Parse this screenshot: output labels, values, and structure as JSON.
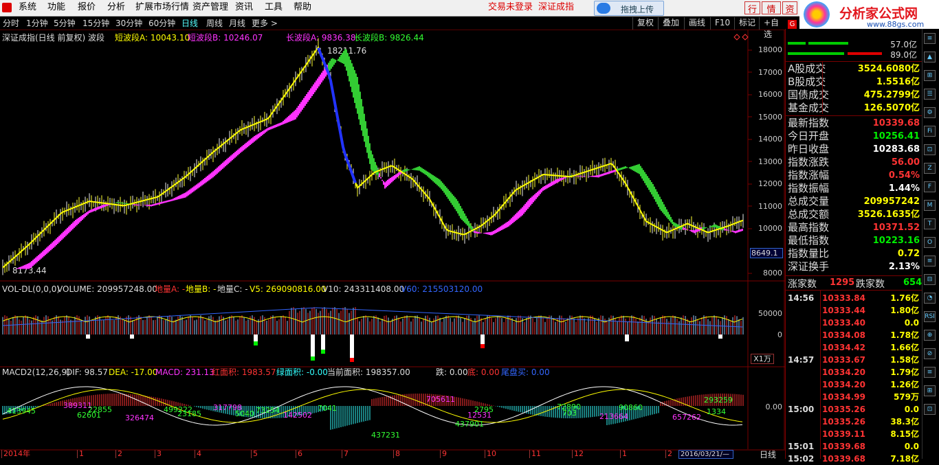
{
  "menu": {
    "items": [
      "系统",
      "功能",
      "报价",
      "分析",
      "扩展市场行情",
      "资产管理",
      "资讯",
      "工具",
      "帮助"
    ],
    "login": "交易未登录",
    "index_name": "深证成指",
    "upload": "拖拽上传",
    "tabs": [
      "行",
      "情",
      "资"
    ]
  },
  "logo": {
    "text": "分析家公式网",
    "url": "www.88gs.com"
  },
  "toolbar": {
    "periods": [
      "分时",
      "1分钟",
      "5分钟",
      "15分钟",
      "30分钟",
      "60分钟",
      "日线",
      "周线",
      "月线",
      "更多 >"
    ],
    "active": "日线",
    "right": [
      "复权",
      "叠加",
      "画线",
      "F10",
      "标记",
      "+自选"
    ]
  },
  "main": {
    "title": "深证成指(日线 前复权) 波段",
    "short_a": "短波段A: 10043.10",
    "short_b": "短波段B: 10246.07",
    "long_a": "长波段A: 9836.38",
    "long_b": "长波段B: 9826.44",
    "high_label": "18211.76",
    "low_label": "8173.44",
    "cur_tag": "8649.1",
    "yticks": [
      "18000",
      "17000",
      "16000",
      "15000",
      "14000",
      "13000",
      "12000",
      "11000",
      "10000",
      "9000",
      "8000"
    ]
  },
  "volume": {
    "title": "VOL-DL(0,0,0)",
    "value": "VOLUME: 209957248.00",
    "dla": "地量A: -",
    "dlb": "地量B: -",
    "dlc": "地量C: -",
    "v5": "V5: 269090816.00",
    "v10": "V10: 243311408.00",
    "v60": "V60: 215503120.00",
    "yticks": [
      "50000",
      "0"
    ],
    "unit": "X1万"
  },
  "macd": {
    "title": "MACD2(12,26,9)",
    "dif": "DIF: 98.57",
    "dea": "DEA: -17.00",
    "macd": "MACD: 231.13",
    "red": "红面积: 1983.57",
    "green": "绿面积: -0.00",
    "cur": "当前面积: 198357.00",
    "die": "跌: 0.00",
    "di": "底: 0.00",
    "tail": "尾盘买: 0.00",
    "ytick": "0.00",
    "area_labels": [
      "413945",
      "389311",
      "62601",
      "22855",
      "326474",
      "499222",
      "23185",
      "317798",
      "5040",
      "73254",
      "142502",
      "7041",
      "437231",
      "705611",
      "2795",
      "437901",
      "12531",
      "72890",
      "703",
      "213664",
      "90860",
      "293259",
      "657262",
      "1334"
    ]
  },
  "xaxis": {
    "labels": [
      "2014年",
      "1",
      "2",
      "3",
      "4",
      "5",
      "6",
      "7",
      "8",
      "9",
      "10",
      "11",
      "12",
      "1",
      "2"
    ],
    "cursor_date": "2016/03/21/—",
    "period": "日线"
  },
  "right": {
    "bar1": "57.0亿",
    "bar2": "89.0亿",
    "market": [
      {
        "k": "A股成交",
        "v": "3524.6080亿"
      },
      {
        "k": "B股成交",
        "v": "1.5516亿"
      },
      {
        "k": "国债成交",
        "v": "475.2799亿"
      },
      {
        "k": "基金成交",
        "v": "126.5070亿"
      }
    ],
    "stats": [
      {
        "k": "最新指数",
        "v": "10339.68",
        "c": "#ff3333"
      },
      {
        "k": "今日开盘",
        "v": "10256.41",
        "c": "#00ee00"
      },
      {
        "k": "昨日收盘",
        "v": "10283.68",
        "c": "#ffffff"
      },
      {
        "k": "指数涨跌",
        "v": "56.00",
        "c": "#ff3333"
      },
      {
        "k": "指数涨幅",
        "v": "0.54%",
        "c": "#ff3333"
      },
      {
        "k": "指数振幅",
        "v": "1.44%",
        "c": "#ffffff"
      },
      {
        "k": "总成交量",
        "v": "209957242",
        "c": "#ffff00"
      },
      {
        "k": "总成交额",
        "v": "3526.1635亿",
        "c": "#ffff00"
      },
      {
        "k": "最高指数",
        "v": "10371.52",
        "c": "#ff3333"
      },
      {
        "k": "最低指数",
        "v": "10223.16",
        "c": "#00ee00"
      },
      {
        "k": "指数量比",
        "v": "0.72",
        "c": "#ffff00"
      },
      {
        "k": "深证换手",
        "v": "2.13%",
        "c": "#ffffff"
      }
    ],
    "up_label": "涨家数",
    "up": "1295",
    "down_label": "跌家数",
    "down": "654",
    "ticks": [
      {
        "t": "14:56",
        "p": "10333.84",
        "v": "1.76亿"
      },
      {
        "t": "",
        "p": "10333.44",
        "v": "1.80亿"
      },
      {
        "t": "",
        "p": "10333.40",
        "v": "0.0"
      },
      {
        "t": "",
        "p": "10334.08",
        "v": "1.78亿"
      },
      {
        "t": "",
        "p": "10334.42",
        "v": "1.66亿"
      },
      {
        "t": "14:57",
        "p": "10333.67",
        "v": "1.58亿"
      },
      {
        "t": "",
        "p": "10334.20",
        "v": "1.79亿"
      },
      {
        "t": "",
        "p": "10334.20",
        "v": "1.26亿"
      },
      {
        "t": "",
        "p": "10334.99",
        "v": "579万"
      },
      {
        "t": "15:00",
        "p": "10335.26",
        "v": "0.0"
      },
      {
        "t": "",
        "p": "10335.26",
        "v": "38.3亿"
      },
      {
        "t": "",
        "p": "10339.11",
        "v": "8.15亿"
      },
      {
        "t": "15:01",
        "p": "10339.68",
        "v": "0.0"
      },
      {
        "t": "15:02",
        "p": "10339.68",
        "v": "7.18亿"
      }
    ]
  },
  "side_icons": [
    "≡",
    "▲",
    "⊞",
    "☰",
    "⚙",
    "Fi",
    "⊡",
    "Z",
    "F",
    "M",
    "T",
    "O",
    "≡",
    "⊟",
    "◔",
    "RSI",
    "⊕",
    "⊘",
    "≡",
    "⊞",
    "⊡"
  ]
}
